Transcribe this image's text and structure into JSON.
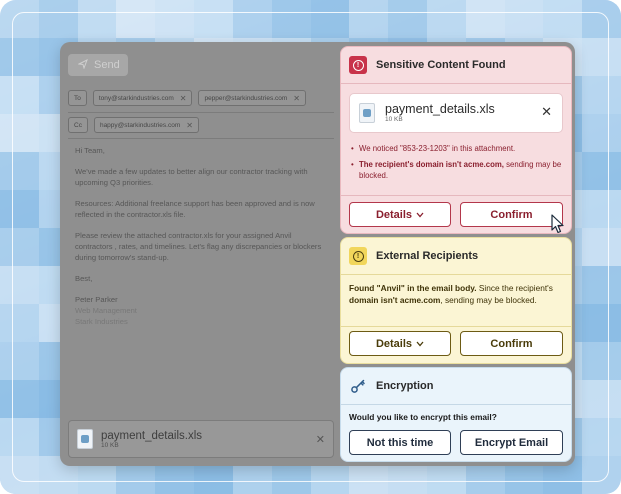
{
  "compose": {
    "send_label": "Send",
    "to_label": "To",
    "to_recipients": [
      "tony@starkindustries.com",
      "pepper@starkindustries.com"
    ],
    "cc_label": "Cc",
    "cc_recipients": [
      "happy@starkindustries.com"
    ],
    "greeting": "Hi Team,",
    "paragraph1": "We've made a few updates to better align our contractor tracking with upcoming Q3 priorities.",
    "paragraph2": "Resources: Additional freelance support has been approved and is now reflected in the contractor.xls file.",
    "paragraph3": "Please review the attached contractor.xls for your assigned Anvil contractors , rates, and timelines. Let's flag any discrepancies or blockers during tomorrow's stand-up.",
    "signoff": "Best,",
    "sig_name": "Peter Parker",
    "sig_title": "Web Management",
    "sig_company": "Stark Industries",
    "attachment": {
      "name": "payment_details.xls",
      "size": "10 KB"
    }
  },
  "sensitive": {
    "title": "Sensitive Content Found",
    "file_name": "payment_details.xls",
    "file_size": "10 KB",
    "bullet1": "We noticed \"853-23-1203\" in this attachment.",
    "bullet2_bold": "The recipient's domain isn't acme.com,",
    "bullet2_rest": " sending may be blocked.",
    "details_label": "Details",
    "confirm_label": "Confirm"
  },
  "external": {
    "title": "External Recipients",
    "msg_bold1": "Found \"Anvil\" in the email body.",
    "msg_mid": " Since the recipient's ",
    "msg_bold2": "domain isn't acme.com",
    "msg_end": ", sending may be blocked.",
    "details_label": "Details",
    "confirm_label": "Confirm"
  },
  "encryption": {
    "title": "Encryption",
    "question": "Would you like to encrypt this email?",
    "decline_label": "Not this time",
    "accept_label": "Encrypt Email"
  },
  "colors": {
    "danger": "#c8334a",
    "warning": "#f1d65b",
    "info": "#eaf4fb"
  }
}
